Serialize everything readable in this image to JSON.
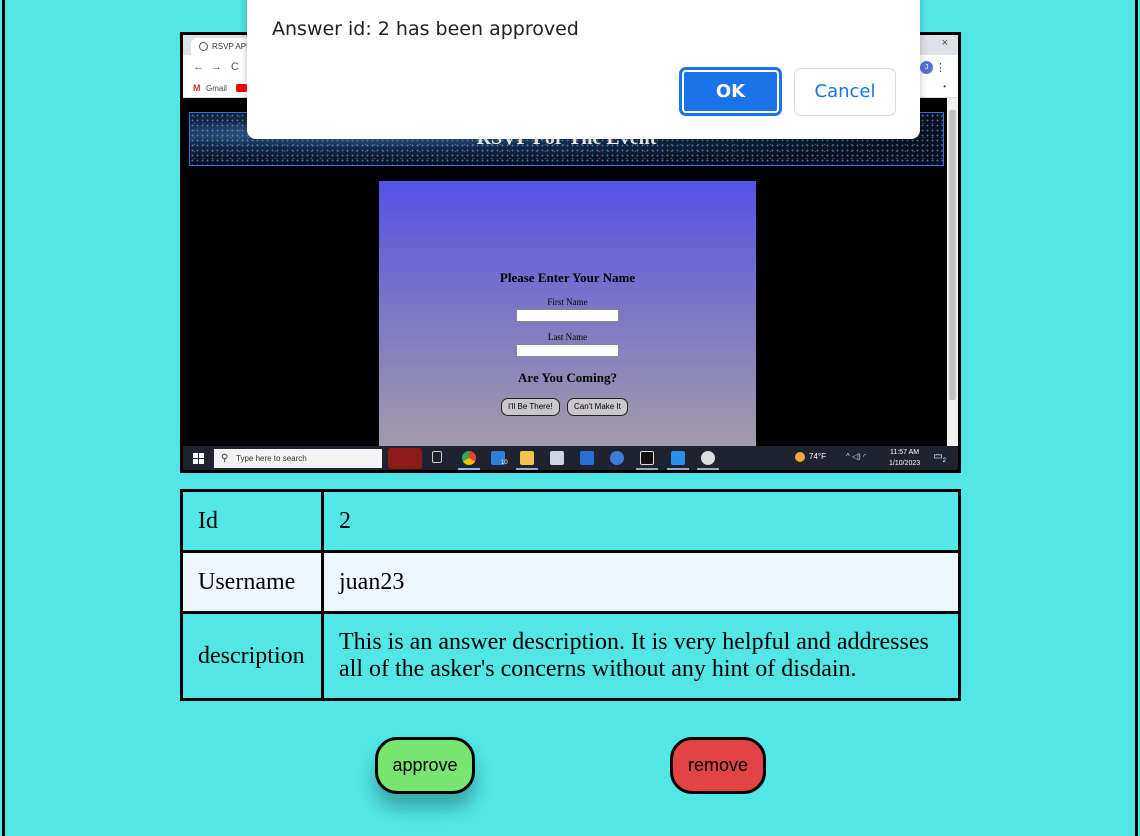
{
  "dialog": {
    "message": "Answer id: 2 has been approved",
    "ok_label": "OK",
    "cancel_label": "Cancel"
  },
  "screenshot": {
    "browser": {
      "tab_title": "RSVP APP",
      "close_glyph": "×",
      "nav_back": "←",
      "nav_forward": "→",
      "nav_reload": "C",
      "profile_initial": "J",
      "bookmark_gmail_glyph": "M",
      "bookmark_gmail": "Gmail"
    },
    "page": {
      "banner_title": "RSVP For The Event",
      "form_heading": "Please Enter Your Name",
      "first_name_label": "First Name",
      "last_name_label": "Last Name",
      "coming_heading": "Are You Coming?",
      "yes_button": "I'll Be There!",
      "no_button": "Can't Make It"
    },
    "taskbar": {
      "search_placeholder": "Type here to search",
      "search_glyph": "⚲",
      "badge_count": "10",
      "temperature": "74°F",
      "time": "11:57 AM",
      "date": "1/10/2023",
      "notification_count": "2"
    }
  },
  "answer": {
    "rows": [
      {
        "key": "Id",
        "value": "2"
      },
      {
        "key": "Username",
        "value": "juan23"
      },
      {
        "key": "description",
        "value": "This is an answer description. It is very helpful and addresses all of the asker's concerns without any hint of disdain."
      }
    ]
  },
  "actions": {
    "approve_label": "approve",
    "remove_label": "remove"
  },
  "colors": {
    "background": "#52e6e6",
    "approve": "#78e66e",
    "remove": "#e24444",
    "dialog_primary": "#1a73e8",
    "username_row": "#eef7ff"
  }
}
